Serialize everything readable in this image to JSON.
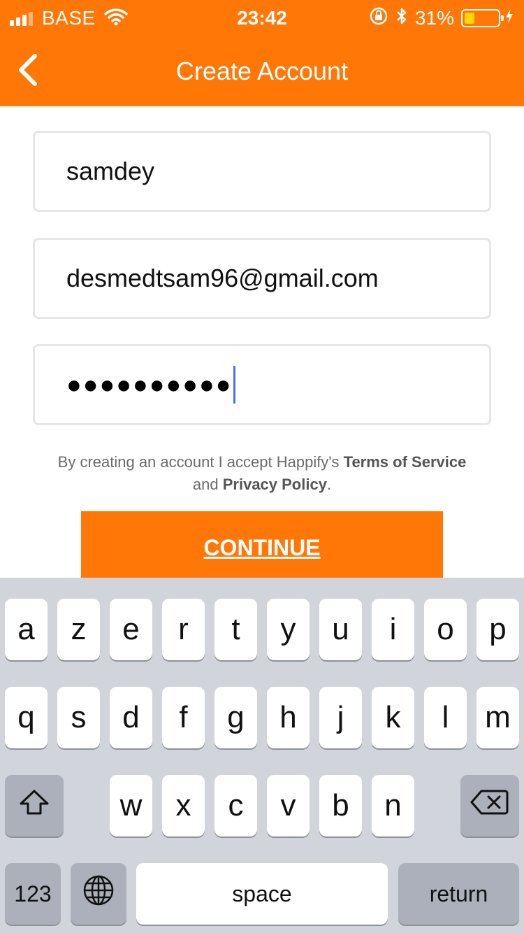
{
  "status_bar": {
    "carrier": "BASE",
    "time": "23:42",
    "battery_percent": "31%",
    "battery_level": 0.31,
    "icons": [
      "signal-icon",
      "wifi-icon",
      "orientation-lock-icon",
      "bluetooth-icon",
      "battery-icon",
      "charging-icon"
    ]
  },
  "nav": {
    "title": "Create Account",
    "back_icon": "chevron-left-icon"
  },
  "form": {
    "username_value": "samdey",
    "email_value": "desmedtsam96@gmail.com",
    "password_masked": "●●●●●●●●●●"
  },
  "terms": {
    "prefix": "By creating an account I accept Happify's ",
    "terms_link": "Terms of Service",
    "middle": "and ",
    "privacy_link": "Privacy Policy",
    "suffix": "."
  },
  "continue_label": "CONTINUE",
  "keyboard": {
    "row1": [
      "a",
      "z",
      "e",
      "r",
      "t",
      "y",
      "u",
      "i",
      "o",
      "p"
    ],
    "row2": [
      "q",
      "s",
      "d",
      "f",
      "g",
      "h",
      "j",
      "k",
      "l",
      "m"
    ],
    "row3": [
      "w",
      "x",
      "c",
      "v",
      "b",
      "n"
    ],
    "numbers_label": "123",
    "space_label": "space",
    "return_label": "return",
    "shift_icon": "shift-icon",
    "delete_icon": "backspace-icon",
    "globe_icon": "globe-icon"
  },
  "colors": {
    "brand": "#fe7707",
    "keyboard_bg": "#d1d5db",
    "caret": "#4c6ef5"
  }
}
